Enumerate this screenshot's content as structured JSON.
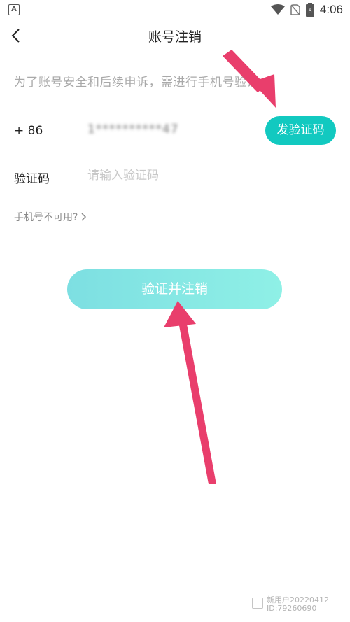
{
  "status_bar": {
    "notif_icon": "A",
    "time": "4:06",
    "battery_level": "6"
  },
  "header": {
    "title": "账号注销"
  },
  "notice": "为了账号安全和后续申诉，需进行手机号验证",
  "phone_row": {
    "country_code": "+ 86",
    "phone_masked": "1**********47",
    "send_code_label": "发验证码"
  },
  "code_row": {
    "label": "验证码",
    "placeholder": "请输入验证码"
  },
  "unavailable_link": "手机号不可用?",
  "submit_label": "验证并注销",
  "watermark": {
    "line1": "新用户20220412",
    "line2": "ID:79260690"
  },
  "colors": {
    "accent": "#12c9c0",
    "submit_gradient_start": "#7ddfe2",
    "submit_gradient_end": "#8ff0e6",
    "arrow": "#e93e6c"
  }
}
